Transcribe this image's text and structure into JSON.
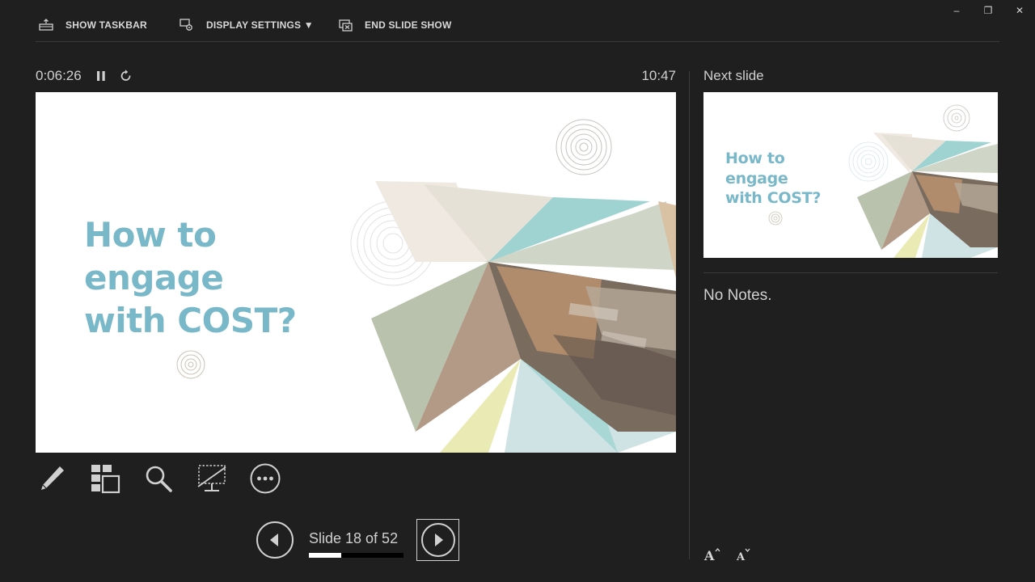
{
  "toolbar": {
    "show_taskbar": "SHOW TASKBAR",
    "display_settings": "DISPLAY SETTINGS",
    "display_settings_caret": "▼",
    "end_slide_show": "END SLIDE SHOW"
  },
  "window_controls": {
    "minimize": "–",
    "restore": "❐",
    "close": "✕"
  },
  "presenter": {
    "elapsed_time": "0:06:26",
    "clock": "10:47"
  },
  "current_slide": {
    "title": "How to\nengage\nwith COST?"
  },
  "navigation": {
    "counter": "Slide 18 of 52",
    "current": 18,
    "total": 52,
    "progress_fraction": 0.346
  },
  "next_slide": {
    "label": "Next slide",
    "title": "How to\nengage\nwith COST?"
  },
  "notes": {
    "text": "No Notes."
  },
  "icons": {
    "pen": "pen-icon",
    "see_all_slides": "see-all-slides-icon",
    "zoom": "zoom-icon",
    "black_screen": "black-screen-icon",
    "more": "more-options-icon"
  },
  "colors": {
    "background": "#1f1f1f",
    "title_accent": "#79b8c9",
    "text": "#d0d0d0"
  }
}
